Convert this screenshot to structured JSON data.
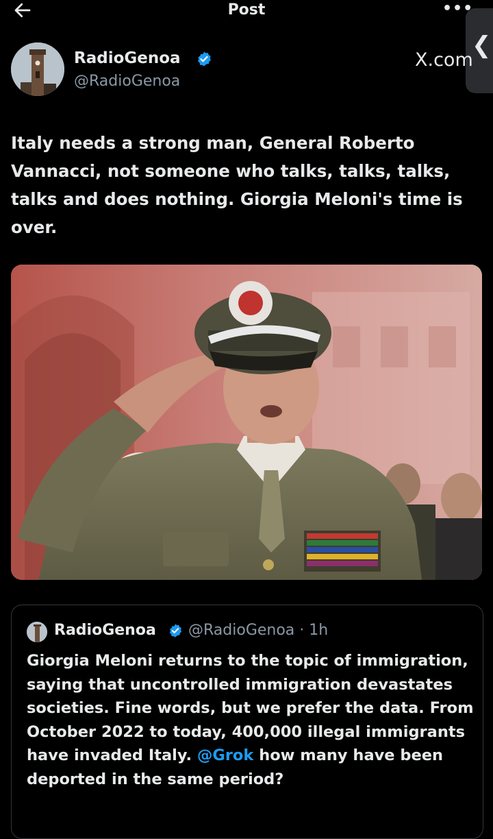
{
  "header": {
    "title": "Post",
    "back_icon": "arrow-left-icon",
    "more_label": "•••",
    "side_handle_label": "❮"
  },
  "author": {
    "name": "RadioGenoa",
    "handle": "@RadioGenoa",
    "source_label": "X.com",
    "verified_color": "#1d9bf0"
  },
  "tweet": {
    "text": "Italy needs a strong man, General Roberto Vannacci, not someone who talks, talks, talks, talks and does nothing. Giorgia Meloni's time is over."
  },
  "quote": {
    "name": "RadioGenoa",
    "handle_time": "@RadioGenoa · 1h",
    "text_before": "Giorgia Meloni returns to the topic of immigration, saying that uncontrolled immigration devastates societies. Fine words, but we prefer the data. From October 2022 to today, 400,000 illegal immigrants have invaded Italy. ",
    "mention": "@Grok",
    "text_after": " how many have been deported in the same period?"
  },
  "colors": {
    "background": "#000000",
    "text": "#e7e9ea",
    "muted": "#8b98a5",
    "link": "#1d9bf0",
    "border": "#333639"
  }
}
